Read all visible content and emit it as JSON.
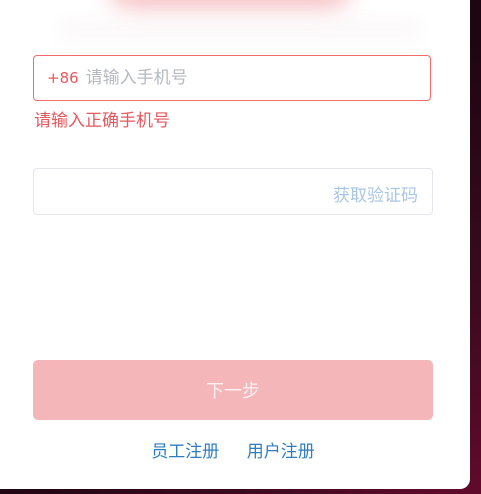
{
  "phone": {
    "prefix": "+86",
    "placeholder": "请输入手机号",
    "value": "",
    "error": "请输入正确手机号"
  },
  "code": {
    "value": "",
    "get_code_label": "获取验证码"
  },
  "next_button_label": "下一步",
  "links": {
    "employee_register": "员工注册",
    "user_register": "用户注册"
  },
  "colors": {
    "error": "#e8575d",
    "link": "#2f7dbf",
    "button_disabled": "#f4b6b9",
    "get_code": "#a9c6e2"
  }
}
